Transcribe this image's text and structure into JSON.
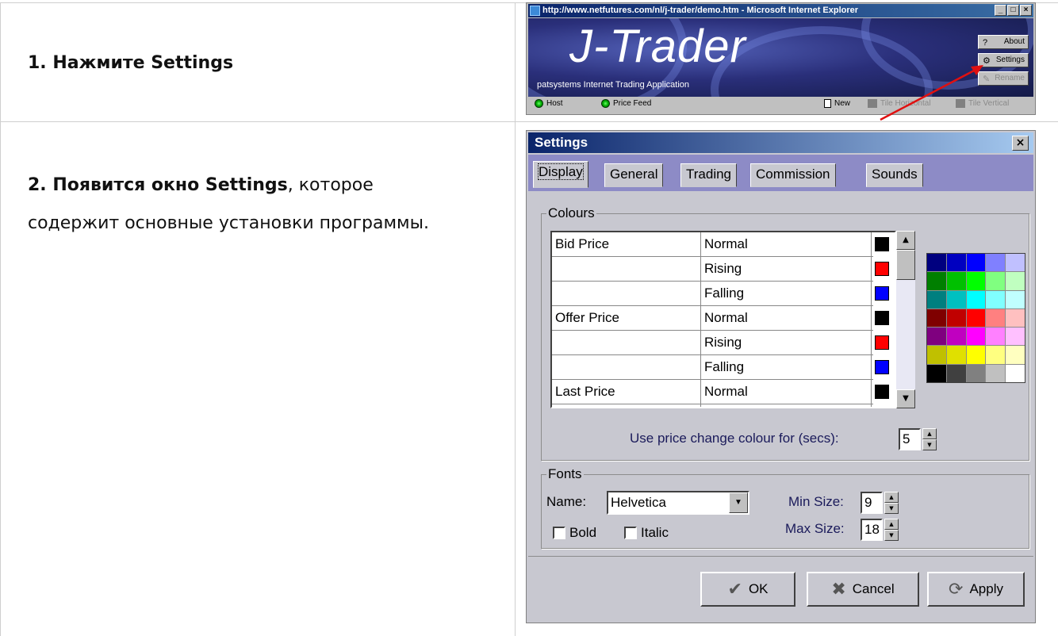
{
  "step1": {
    "bold": "1. Нажмите Settings"
  },
  "step2": {
    "bold": "2. Появится окно Settings",
    "line1": ", которое",
    "line2": "содержит основные установки программы."
  },
  "ie_window": {
    "title": "http://www.netfutures.com/nl/j-trader/demo.htm - Microsoft Internet Explorer",
    "brand": "J-Trader",
    "tagline": "patsystems Internet Trading Application",
    "buttons": {
      "about": "About",
      "settings": "Settings",
      "rename": "Rename"
    },
    "status": {
      "host": "Host",
      "price_feed": "Price Feed",
      "new": "New",
      "tile_horizontal": "Tile Horizontal",
      "tile_vertical": "Tile Vertical"
    }
  },
  "settings": {
    "title": "Settings",
    "tabs": [
      "Display",
      "General",
      "Trading",
      "Commission",
      "Sounds"
    ],
    "colours": {
      "label": "Colours",
      "rows": [
        {
          "name": "Bid Price",
          "state": "Normal",
          "color": "#000000"
        },
        {
          "name": "",
          "state": "Rising",
          "color": "#ff0000"
        },
        {
          "name": "",
          "state": "Falling",
          "color": "#0000ff"
        },
        {
          "name": "Offer Price",
          "state": "Normal",
          "color": "#000000"
        },
        {
          "name": "",
          "state": "Rising",
          "color": "#ff0000"
        },
        {
          "name": "",
          "state": "Falling",
          "color": "#0000ff"
        },
        {
          "name": "Last Price",
          "state": "Normal",
          "color": "#000000"
        }
      ],
      "palette": [
        "#00007f",
        "#0000c0",
        "#0000ff",
        "#8080ff",
        "#c0c0ff",
        "#007f00",
        "#00c000",
        "#00ff00",
        "#80ff80",
        "#c0ffc0",
        "#007f7f",
        "#00c0c0",
        "#00ffff",
        "#80ffff",
        "#c0ffff",
        "#7f0000",
        "#c00000",
        "#ff0000",
        "#ff8080",
        "#ffc0c0",
        "#7f007f",
        "#c000c0",
        "#ff00ff",
        "#ff80ff",
        "#ffc0ff",
        "#c0c000",
        "#e0e000",
        "#ffff00",
        "#ffff80",
        "#ffffc0",
        "#000000",
        "#404040",
        "#808080",
        "#c0c0c0",
        "#ffffff"
      ],
      "price_change_label": "Use price change colour for (secs):",
      "price_change_value": "5"
    },
    "fonts": {
      "label": "Fonts",
      "name_label": "Name:",
      "name_value": "Helvetica",
      "min_label": "Min Size:",
      "min_value": "9",
      "max_label": "Max Size:",
      "max_value": "18",
      "bold_label": "Bold",
      "italic_label": "Italic"
    },
    "buttons": {
      "ok": "OK",
      "cancel": "Cancel",
      "apply": "Apply"
    }
  }
}
